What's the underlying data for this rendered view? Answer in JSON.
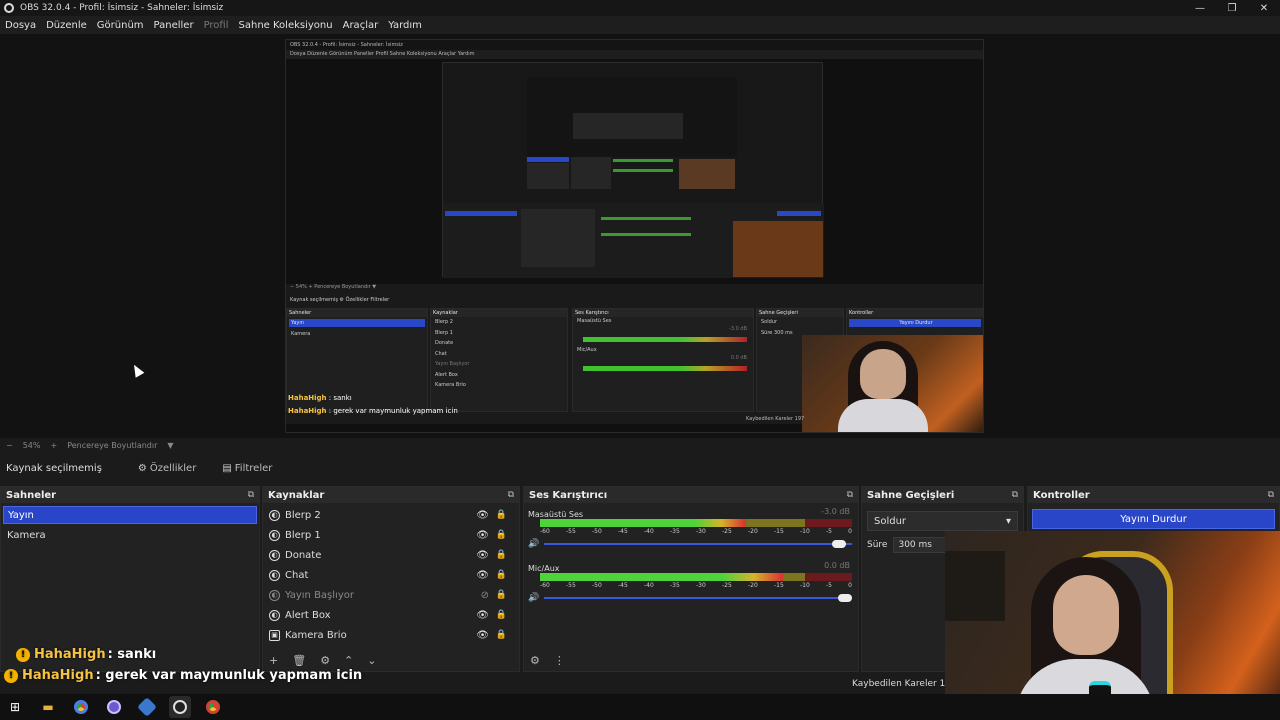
{
  "window": {
    "title": "OBS 32.0.4 - Profil: İsimsiz - Sahneler: İsimsiz",
    "minimize": "—",
    "restore": "❐",
    "close": "✕"
  },
  "menu": {
    "items": [
      "Dosya",
      "Düzenle",
      "Görünüm",
      "Paneller",
      "Profil",
      "Sahne Koleksiyonu",
      "Araçlar",
      "Yardım"
    ]
  },
  "preview_bar": {
    "minus": "−",
    "zoom": "54%",
    "plus": "+",
    "mode": "Pencereye Boyutlandır",
    "arrow": "▼"
  },
  "source_toolbar": {
    "status": "Kaynak seçilmemiş",
    "properties": "Özellikler",
    "filters": "Filtreler"
  },
  "scenes": {
    "title": "Sahneler",
    "items": [
      "Yayın",
      "Kamera"
    ],
    "selected": 0
  },
  "sources": {
    "title": "Kaynaklar",
    "items": [
      {
        "name": "Blerp 2",
        "visible": true
      },
      {
        "name": "Blerp 1",
        "visible": true
      },
      {
        "name": "Donate",
        "visible": true
      },
      {
        "name": "Chat",
        "visible": true
      },
      {
        "name": "Yayın Başlıyor",
        "visible": false
      },
      {
        "name": "Alert Box",
        "visible": true
      },
      {
        "name": "Kamera Brio",
        "visible": true
      }
    ],
    "footer": [
      "+",
      "🗑",
      "⚙",
      "⌃",
      "⌄"
    ]
  },
  "mixer": {
    "title": "Ses Karıştırıcı",
    "channels": [
      {
        "name": "Masaüstü Ses",
        "db": "-3.0 dB",
        "level": 0.66,
        "volume": 0.98
      },
      {
        "name": "Mic/Aux",
        "db": "0.0 dB",
        "level": 0.78,
        "volume": 1.0
      }
    ],
    "ticks": [
      "-60",
      "-55",
      "-50",
      "-45",
      "-40",
      "-35",
      "-30",
      "-25",
      "-20",
      "-15",
      "-10",
      "-5",
      "0"
    ]
  },
  "transitions": {
    "title": "Sahne Geçişleri",
    "selected": "Soldur",
    "duration_label": "Süre",
    "duration_value": "300 ms"
  },
  "controls": {
    "title": "Kontroller",
    "stop_stream": "Yayını Durdur"
  },
  "chat": [
    {
      "nick": "HahaHigh",
      "message": ": sankı"
    },
    {
      "nick": "HahaHigh",
      "message": ": gerek var maymunluk yapmam icin"
    }
  ],
  "statusbar": {
    "dropped": "Kaybedilen Kareler 197"
  },
  "nested": {
    "title": "OBS 32.0.4 - Profil: İsimsiz - Sahneler: İsimsiz",
    "menu": "Dosya   Düzenle   Görünüm   Paneller   Profil   Sahne Koleksiyonu   Araçlar   Yardım",
    "status": "− 54% +   Pencereye Boyutlandır ▼",
    "toolbar": "Kaynak seçilmemiş     ⚙ Özellikler     Filtreler",
    "docks": [
      "Sahneler",
      "Kaynaklar",
      "Ses Karıştırıcı",
      "Sahne Geçişleri",
      "Kontroller"
    ],
    "scene_selected": "Yayın",
    "scene_other": "Kamera",
    "sources": [
      "Blerp 2",
      "Blerp 1",
      "Donate",
      "Chat",
      "Yayın Başlıyor",
      "Alert Box",
      "Kamera Brio"
    ],
    "mixer_ch1": "Masaüstü Ses",
    "mixer_ch2": "Mic/Aux",
    "mixer_db1": "-3.0 dB",
    "mixer_db2": "0.0 dB",
    "transition": "Soldur",
    "duration": "Süre   300 ms",
    "stop": "Yayını Durdur",
    "dropped": "Kaybedilen Kareler 197",
    "chat1_nick": "HahaHigh",
    "chat1_msg": ": sankı",
    "chat2_nick": "HahaHigh",
    "chat2_msg": ": gerek var maymunluk yapmam icin"
  }
}
